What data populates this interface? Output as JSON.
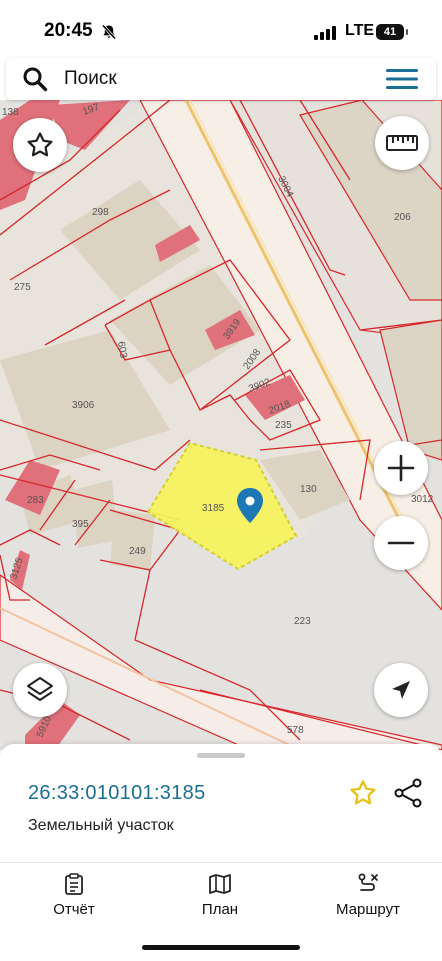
{
  "status_bar": {
    "time": "20:45",
    "network": "LTE",
    "battery": "41"
  },
  "search": {
    "placeholder": "Поиск"
  },
  "map": {
    "labels": [
      "138",
      "197",
      "298",
      "275",
      "603",
      "3919",
      "2008",
      "3902",
      "2018",
      "235",
      "3906",
      "130",
      "3185",
      "3012",
      "283",
      "395",
      "249",
      "3125",
      "223",
      "578",
      "206",
      "3004",
      "5910"
    ],
    "highlight_color": "#f7f35a",
    "parcel_border_color": "#d8262b",
    "building_color": "#e0707a"
  },
  "sheet": {
    "cadastral_number": "26:33:010101:3185",
    "land_type": "Земельный участок",
    "accent_color": "#1b6f96",
    "star_color": "#e7c21e"
  },
  "tabs": [
    {
      "label": "Отчёт",
      "icon": "report-icon"
    },
    {
      "label": "План",
      "icon": "map-plan-icon"
    },
    {
      "label": "Маршрут",
      "icon": "route-icon"
    }
  ]
}
